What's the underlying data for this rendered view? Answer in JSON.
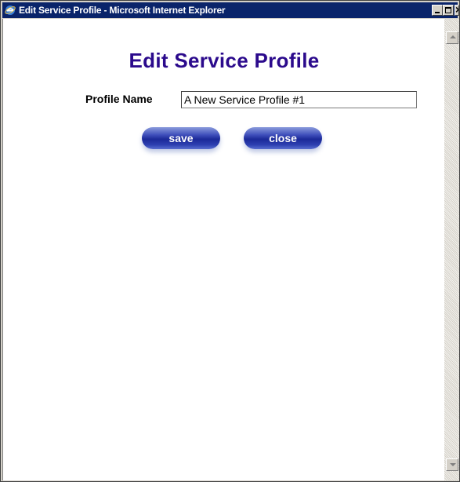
{
  "window": {
    "title": "Edit Service Profile - Microsoft Internet Explorer",
    "icon": "internet-explorer-icon"
  },
  "page": {
    "heading": "Edit Service Profile",
    "profile_name_label": "Profile Name",
    "profile_name_value": "A New Service Profile #1"
  },
  "buttons": {
    "save_label": "save",
    "close_label": "close"
  },
  "colors": {
    "titlebar": "#0a246a",
    "heading": "#2b0a8c",
    "button": "#1c2a99"
  }
}
